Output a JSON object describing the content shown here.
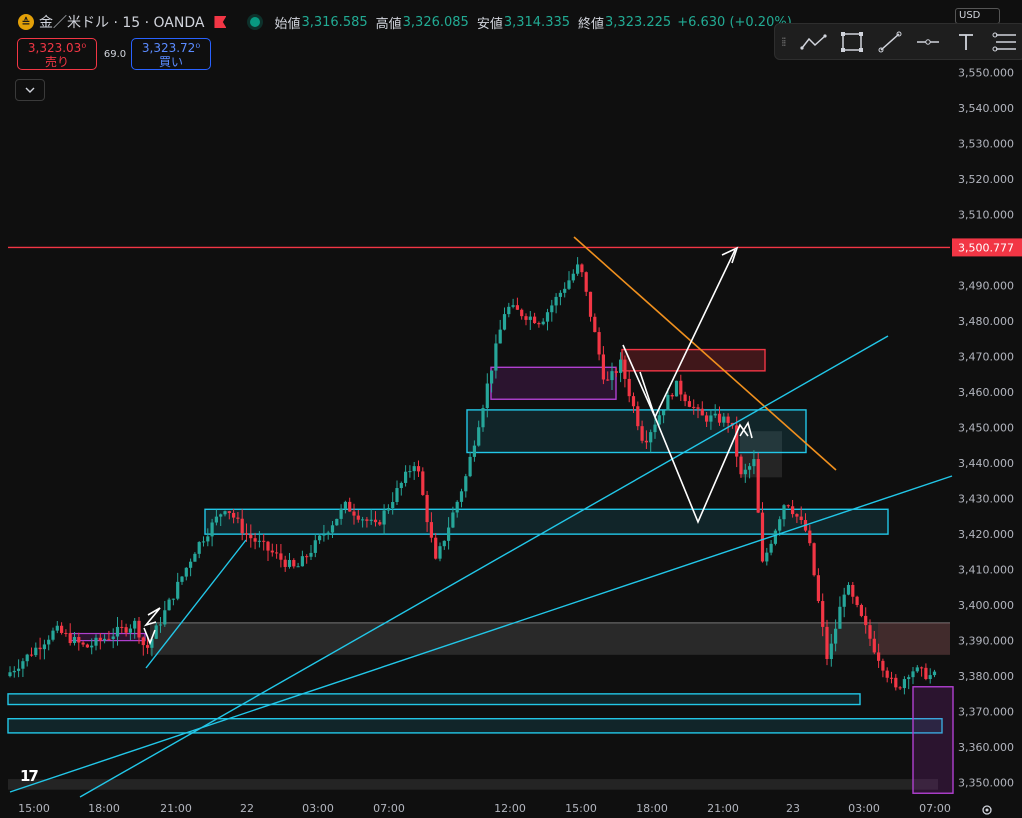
{
  "legend": {
    "symbol_icon": "gold-coin-icon",
    "title": "金／米ドル · 15 · OANDA",
    "open_label": "始値",
    "open_value": "3,316.585",
    "high_label": "高値",
    "high_value": "3,326.085",
    "low_label": "安値",
    "low_value": "3,314.335",
    "close_label": "終値",
    "close_value": "3,323.225",
    "change": "+6.630 (+0.20%)"
  },
  "trade": {
    "sell_price": "3,323.03⁰",
    "sell_label": "売り",
    "spread": "69.0",
    "buy_price": "3,323.72⁰",
    "buy_label": "買い"
  },
  "currency": "USD",
  "price_axis": {
    "ticks": [
      "3,550.000",
      "3,540.000",
      "3,530.000",
      "3,520.000",
      "3,510.000",
      "3,490.000",
      "3,480.000",
      "3,470.000",
      "3,460.000",
      "3,450.000",
      "3,440.000",
      "3,430.000",
      "3,420.000",
      "3,410.000",
      "3,400.000",
      "3,390.000",
      "3,380.000",
      "3,370.000",
      "3,360.000",
      "3,350.000"
    ],
    "alert_label": "3,500.777"
  },
  "time_axis": {
    "ticks": [
      "15:00",
      "18:00",
      "21:00",
      "22",
      "03:00",
      "07:00",
      "12:00",
      "15:00",
      "18:00",
      "21:00",
      "23",
      "03:00",
      "07:00"
    ]
  },
  "chart_data": {
    "type": "candlestick",
    "symbol": "XAUUSD",
    "ylim": [
      3346,
      3556
    ],
    "alert_level": 3500.777,
    "zones": [
      {
        "name": "supply-zone",
        "top": 3472,
        "bottom": 3466
      },
      {
        "name": "demand-zone-upper",
        "top": 3455,
        "bottom": 3443
      },
      {
        "name": "demand-zone-mid",
        "top": 3427,
        "bottom": 3420
      },
      {
        "name": "demand-zone-low-1",
        "top": 3375,
        "bottom": 3372
      },
      {
        "name": "demand-zone-low-2",
        "top": 3368,
        "bottom": 3364
      }
    ],
    "colors": {
      "up": "#26a69a",
      "down": "#f23645",
      "zone": "#22c7e8",
      "alert": "#f23645",
      "trend": "#f0901e",
      "bg": "#0f0f0f"
    }
  },
  "toolbar": {
    "items": [
      "trend-line-icon",
      "rectangle-icon",
      "line-icon",
      "horizontal-line-icon",
      "text-icon",
      "fib-icon"
    ]
  },
  "logo": "17"
}
